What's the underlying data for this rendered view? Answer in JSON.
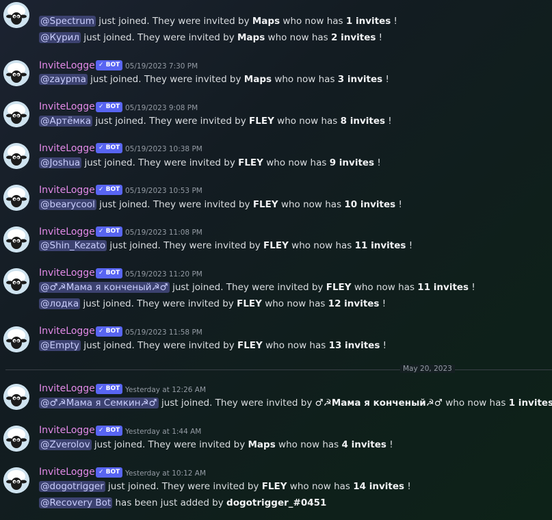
{
  "messages": [
    {
      "lines": [
        {
          "mention": "@Spectrum",
          "text1": " just joined. They were invited by ",
          "inviter": "Maps",
          "text2": " who now has ",
          "count": "1 invites",
          "text3": " !"
        },
        {
          "mention": "@Курил",
          "text1": " just joined. They were invited by ",
          "inviter": "Maps",
          "text2": " who now has ",
          "count": "2 invites",
          "text3": " !"
        }
      ]
    },
    {
      "author": "InviteLogger",
      "bot": "✓ BOT",
      "time": "05/19/2023 7:30 PM",
      "lines": [
        {
          "mention": "@zaypma",
          "text1": " just joined. They were invited by ",
          "inviter": "Maps",
          "text2": " who now has ",
          "count": "3 invites",
          "text3": " !"
        }
      ]
    },
    {
      "author": "InviteLogger",
      "bot": "✓ BOT",
      "time": "05/19/2023 9:08 PM",
      "lines": [
        {
          "mention": "@Артёмка",
          "text1": " just joined. They were invited by ",
          "inviter": "FLEY",
          "text2": " who now has ",
          "count": "8 invites",
          "text3": " !"
        }
      ]
    },
    {
      "author": "InviteLogger",
      "bot": "✓ BOT",
      "time": "05/19/2023 10:38 PM",
      "lines": [
        {
          "mention": "@Joshua",
          "text1": " just joined. They were invited by ",
          "inviter": "FLEY",
          "text2": " who now has ",
          "count": "9 invites",
          "text3": " !"
        }
      ]
    },
    {
      "author": "InviteLogger",
      "bot": "✓ BOT",
      "time": "05/19/2023 10:53 PM",
      "lines": [
        {
          "mention": "@bearycool",
          "text1": " just joined. They were invited by ",
          "inviter": "FLEY",
          "text2": " who now has ",
          "count": "10 invites",
          "text3": " !"
        }
      ]
    },
    {
      "author": "InviteLogger",
      "bot": "✓ BOT",
      "time": "05/19/2023 11:08 PM",
      "lines": [
        {
          "mention": "@Shin_Kezato",
          "text1": " just joined. They were invited by ",
          "inviter": "FLEY",
          "text2": " who now has ",
          "count": "11 invites",
          "text3": " !"
        }
      ]
    },
    {
      "author": "InviteLogger",
      "bot": "✓ BOT",
      "time": "05/19/2023 11:20 PM",
      "lines": [
        {
          "mention": "@♂☭Мама я конченый☭♂",
          "text1": " just joined. They were invited by ",
          "inviter": "FLEY",
          "text2": " who now has ",
          "count": "11 invites",
          "text3": " !"
        },
        {
          "mention": "@лодка",
          "text1": " just joined. They were invited by ",
          "inviter": "FLEY",
          "text2": " who now has ",
          "count": "12 invites",
          "text3": " !"
        }
      ]
    },
    {
      "author": "InviteLogger",
      "bot": "✓ BOT",
      "time": "05/19/2023 11:58 PM",
      "lines": [
        {
          "mention": "@Empty",
          "text1": " just joined. They were invited by ",
          "inviter": "FLEY",
          "text2": " who now has ",
          "count": "13 invites",
          "text3": " !"
        }
      ]
    },
    {
      "author": "InviteLogger",
      "bot": "✓ BOT",
      "time": "Yesterday at 12:26 AM",
      "lines": [
        {
          "mention": "@♂☭Мама я Семкин☭♂",
          "text1": " just joined. They were invited by ",
          "inviter": "♂☭Мама я конченый☭♂",
          "text2": " who now has ",
          "count": "1 invites",
          "text3": " !"
        }
      ]
    },
    {
      "author": "InviteLogger",
      "bot": "✓ BOT",
      "time": "Yesterday at 1:44 AM",
      "lines": [
        {
          "mention": "@Zverolov",
          "text1": " just joined. They were invited by ",
          "inviter": "Maps",
          "text2": " who now has ",
          "count": "4 invites",
          "text3": " !"
        }
      ]
    },
    {
      "author": "InviteLogger",
      "bot": "✓ BOT",
      "time": "Yesterday at 10:12 AM",
      "lines": [
        {
          "mention": "@dogotrigger",
          "text1": " just joined. They were invited by ",
          "inviter": "FLEY",
          "text2": " who now has ",
          "count": "14 invites",
          "text3": " !"
        },
        {
          "mention": "@Recovery Bot",
          "text1": " has been just added by ",
          "inviter": "dogotrigger_#0451",
          "text2": "",
          "count": "",
          "text3": ""
        }
      ]
    }
  ],
  "date_divider": "May 20, 2023",
  "colors": {
    "username": "#e38ae8",
    "bot_badge": "#5865f2",
    "mention_bg": "#3c4270"
  }
}
